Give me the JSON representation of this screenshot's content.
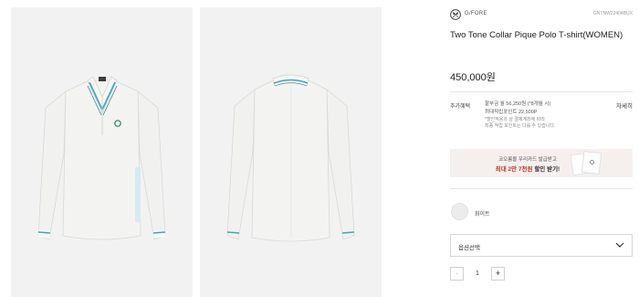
{
  "brand": {
    "name": "G/FORE",
    "code": "GNTNW22404BUX",
    "logo_icon": "brand-skull-logo"
  },
  "product": {
    "title": "Two Tone Collar Pique Polo T-shirt(WOMEN)",
    "price": "450,000원",
    "images": [
      {
        "view": "front",
        "alt": "front-view polo shirt",
        "accent_color": "#3aa8b8"
      },
      {
        "view": "back",
        "alt": "back-view polo shirt",
        "accent_color": "#3aa8b8"
      }
    ]
  },
  "benefits": {
    "label": "추가혜택",
    "line1": "할부금 월 56,250원 (*8개월 시)",
    "line2": "최대적립포인트 22,500P",
    "note1": "*할인적용과 상 결제계좌에 따라",
    "note2": "최종 적립 포인트는 다를 수 있습니다.",
    "detail_link": "자세히"
  },
  "banner": {
    "line1": "코오롱몰 우리카드 발급받고",
    "line2_accent": "최대 2만 7천원",
    "line2_rest": "할인 받기!"
  },
  "color": {
    "name": "화이트",
    "swatch": "#ececec"
  },
  "option": {
    "label": "옵션선택",
    "chevron_icon": "chevron-down-icon"
  },
  "quantity": {
    "minus": "-",
    "value": "1",
    "plus": "+"
  },
  "colors": {
    "shirt": "#f1f1ef",
    "collar_stripe": "#3aa8b8",
    "background": "#f2f2f2"
  }
}
